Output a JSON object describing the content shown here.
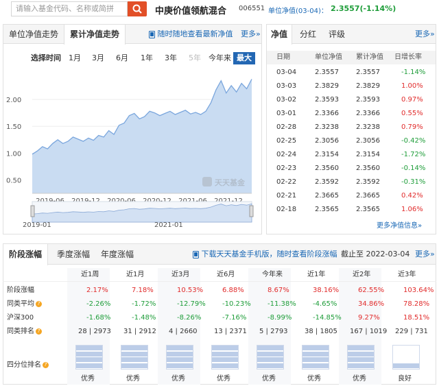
{
  "header": {
    "search_placeholder": "请输入基金代码、名称或简拼",
    "fund_name": "中庚价值领航混合",
    "fund_code": "006551",
    "nav_label": "单位净值(03-04)：",
    "nav_value": "2.3557(-1.14%)"
  },
  "chart_panel": {
    "tabs": [
      "单位净值走势",
      "累计净值走势"
    ],
    "active_tab": "累计净值走势",
    "mobile_link": "随时随地查看最新净值",
    "more": "更多»",
    "period_label": "选择时间",
    "periods": [
      "1月",
      "3月",
      "6月",
      "1年",
      "3年",
      "5年",
      "今年来",
      "最大"
    ],
    "selected_period": "最大",
    "disabled_period": "5年",
    "watermark": "天天基金"
  },
  "chart_data": {
    "type": "area",
    "y_ticks": [
      "2.00",
      "1.50",
      "1.00",
      "0.50"
    ],
    "ylim": [
      0.25,
      2.5
    ],
    "x_ticks": [
      "2019-06",
      "2019-12",
      "2020-06",
      "2020-12",
      "2021-06",
      "2021-12"
    ],
    "nav_x_ticks": [
      "2019-01",
      "2021-01"
    ],
    "values": [
      0.98,
      1.04,
      1.12,
      1.08,
      1.18,
      1.25,
      1.18,
      1.22,
      1.3,
      1.26,
      1.22,
      1.28,
      1.24,
      1.33,
      1.3,
      1.42,
      1.35,
      1.52,
      1.56,
      1.7,
      1.74,
      1.64,
      1.68,
      1.78,
      1.75,
      1.7,
      1.74,
      1.78,
      1.72,
      1.76,
      1.8,
      1.73,
      1.76,
      1.72,
      1.78,
      1.94,
      2.18,
      2.35,
      2.12,
      2.26,
      2.14,
      2.3,
      2.2,
      2.38
    ],
    "accent": "#7aa6dd"
  },
  "nav_panel": {
    "tabs": [
      "净值",
      "分红",
      "评级"
    ],
    "active_tab": "净值",
    "more": "更多»",
    "headers": [
      "日期",
      "单位净值",
      "累计净值",
      "日增长率"
    ],
    "rows": [
      [
        "03-04",
        "2.3557",
        "2.3557",
        "-1.14%"
      ],
      [
        "03-03",
        "2.3829",
        "2.3829",
        "1.00%"
      ],
      [
        "03-02",
        "2.3593",
        "2.3593",
        "0.97%"
      ],
      [
        "03-01",
        "2.3366",
        "2.3366",
        "0.55%"
      ],
      [
        "02-28",
        "2.3238",
        "2.3238",
        "0.79%"
      ],
      [
        "02-25",
        "2.3056",
        "2.3056",
        "-0.42%"
      ],
      [
        "02-24",
        "2.3154",
        "2.3154",
        "-1.72%"
      ],
      [
        "02-23",
        "2.3560",
        "2.3560",
        "-0.14%"
      ],
      [
        "02-22",
        "2.3592",
        "2.3592",
        "-0.31%"
      ],
      [
        "02-21",
        "2.3665",
        "2.3665",
        "0.42%"
      ],
      [
        "02-18",
        "2.3565",
        "2.3565",
        "1.06%"
      ]
    ],
    "more_link": "更多净值信息»"
  },
  "stage_panel": {
    "tabs": [
      "阶段涨幅",
      "季度涨幅",
      "年度涨幅"
    ],
    "active_tab": "阶段涨幅",
    "download": "下载天天基金手机版，随时查看阶段涨幅",
    "cutoff_label": "截止至",
    "cutoff_date": "2022-03-04",
    "more": "更多»",
    "columns": [
      "近1周",
      "近1月",
      "近3月",
      "近6月",
      "今年来",
      "近1年",
      "近2年",
      "近3年"
    ],
    "rows": [
      {
        "label": "阶段涨幅",
        "values": [
          "2.17%",
          "7.18%",
          "10.53%",
          "6.88%",
          "8.67%",
          "38.16%",
          "62.55%",
          "103.64%"
        ]
      },
      {
        "label": "同类平均",
        "values": [
          "-2.26%",
          "-1.72%",
          "-12.79%",
          "-10.23%",
          "-11.38%",
          "-4.65%",
          "34.86%",
          "78.28%"
        ]
      },
      {
        "label": "沪深300",
        "values": [
          "-1.68%",
          "-1.48%",
          "-8.26%",
          "-7.16%",
          "-8.99%",
          "-14.85%",
          "9.27%",
          "18.51%"
        ]
      },
      {
        "label": "同类排名",
        "values": [
          "28 | 2973",
          "31 | 2912",
          "4 | 2660",
          "13 | 2371",
          "5 | 2793",
          "38 | 1805",
          "167 | 1019",
          "229 | 731"
        ]
      }
    ],
    "quartile_label": "四分位排名",
    "quartile_fill": [
      4,
      4,
      4,
      4,
      4,
      4,
      4,
      1
    ],
    "quartile_values": [
      "优秀",
      "优秀",
      "优秀",
      "优秀",
      "优秀",
      "优秀",
      "优秀",
      "良好"
    ]
  },
  "colors": {
    "red": "#e12b2b",
    "green": "#1d9c38",
    "blue": "#1a68b5",
    "brand": "#e24f27"
  }
}
